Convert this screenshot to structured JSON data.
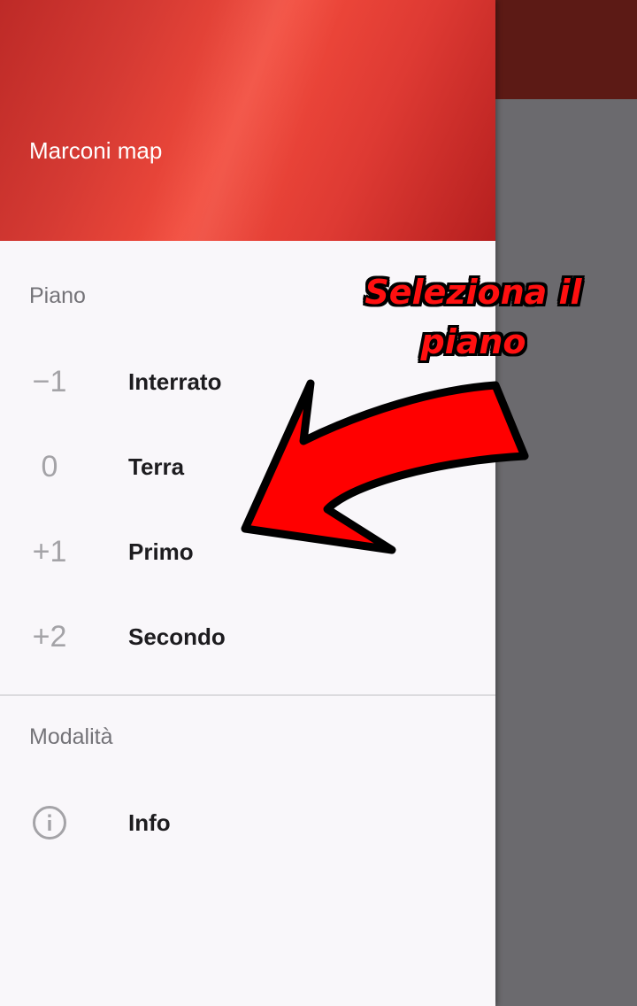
{
  "drawer": {
    "header_title": "Marconi map",
    "floor_section_title": "Piano",
    "floors": [
      {
        "badge": "−1",
        "label": "Interrato"
      },
      {
        "badge": "0",
        "label": "Terra"
      },
      {
        "badge": "+1",
        "label": "Primo"
      },
      {
        "badge": "+2",
        "label": "Secondo"
      }
    ],
    "mode_section_title": "Modalità",
    "modes": [
      {
        "icon": "info-icon",
        "label": "Info"
      }
    ]
  },
  "annotation": {
    "text_line1": "Seleziona il",
    "text_line2": "piano",
    "arrow_icon": "red-arrow-icon"
  },
  "colors": {
    "header_red": "#f24b3c",
    "toolbar_dark_red": "#5c1a15",
    "scrim_gray": "#6b6a6e",
    "drawer_bg": "#f9f7fa",
    "annotation_red": "#ff0000"
  }
}
